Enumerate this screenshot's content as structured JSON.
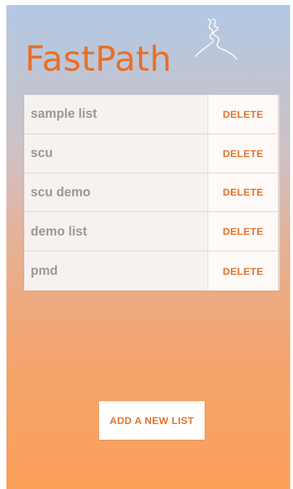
{
  "app": {
    "title": "FastPath",
    "logo_icon": "winding-path-icon"
  },
  "colors": {
    "accent": "#e96f27",
    "gradient_top": "#b2c8e4",
    "gradient_bottom": "#fb9f59"
  },
  "lists": [
    {
      "name": "sample list",
      "action": "DELETE"
    },
    {
      "name": "scu",
      "action": "DELETE"
    },
    {
      "name": "scu demo",
      "action": "DELETE"
    },
    {
      "name": "demo list",
      "action": "DELETE"
    },
    {
      "name": "pmd",
      "action": "DELETE"
    }
  ],
  "add_button": {
    "label": "ADD A NEW LIST"
  }
}
